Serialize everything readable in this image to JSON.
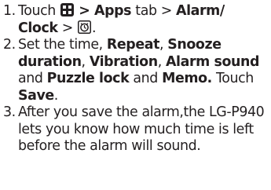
{
  "steps": [
    {
      "number": "1.",
      "touch": "Touch",
      "apps_icon": "apps-grid-icon",
      "apps_tab": "> Apps",
      "apps_tab_suffix": "tab >",
      "alarm_clock": "Alarm/ Clock",
      "sep": ">",
      "alarm_icon": "alarm-clock-icon",
      "end": "."
    },
    {
      "number": "2.",
      "set_the": "Set the time,",
      "repeat": "Repeat",
      "comma1": ",",
      "snooze": "Snooze duration",
      "comma2": ",",
      "vibration": "Vibration",
      "comma3": ",",
      "alarm_sound": "Alarm sound",
      "and1": "and",
      "puzzle_lock": "Puzzle lock",
      "and2": "and",
      "memo": "Memo.",
      "touch": "Touch",
      "save": "Save",
      "end": "."
    },
    {
      "number": "3.",
      "text": "After you save the alarm,the LG-P940 lets you know how much time is left before the alarm will sound."
    }
  ],
  "colors": {
    "text": "#231f20",
    "background": "#ffffff"
  }
}
